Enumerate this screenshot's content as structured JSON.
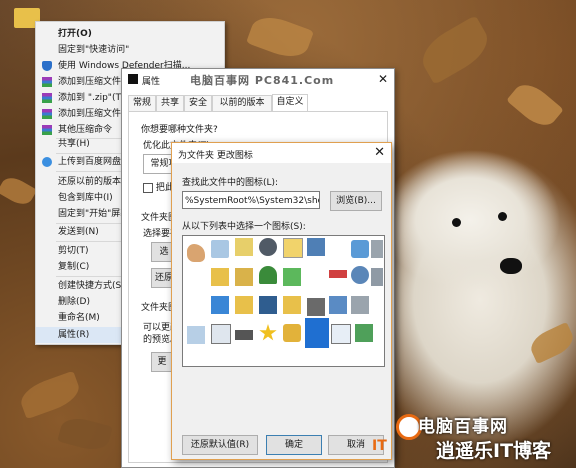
{
  "context_menu": {
    "items": [
      {
        "label": "打开(O)",
        "bold": true,
        "icon": ""
      },
      {
        "label": "固定到\"快速访问\"",
        "icon": ""
      },
      {
        "label": "使用 Windows Defender扫描...",
        "icon": "shield-icon"
      },
      {
        "label": "添加到压缩文件(A)...",
        "icon": "archive-icon"
      },
      {
        "label": "添加到 \".zip\"(T)",
        "icon": "archive-icon"
      },
      {
        "label": "添加到压缩文件并...",
        "icon": "archive-icon"
      },
      {
        "label": "其他压缩命令",
        "icon": "archive-icon"
      },
      {
        "label": "共享(H)",
        "icon": ""
      },
      {
        "label": "上传到百度网盘",
        "icon": "cloud-icon"
      },
      {
        "label": "还原以前的版本(V)",
        "icon": ""
      },
      {
        "label": "包含到库中(I)",
        "icon": ""
      },
      {
        "label": "固定到\"开始\"屏幕(P)",
        "icon": ""
      },
      {
        "label": "发送到(N)",
        "icon": ""
      },
      {
        "label": "剪切(T)",
        "icon": ""
      },
      {
        "label": "复制(C)",
        "icon": ""
      },
      {
        "label": "创建快捷方式(S)",
        "icon": ""
      },
      {
        "label": "删除(D)",
        "icon": ""
      },
      {
        "label": "重命名(M)",
        "icon": ""
      },
      {
        "label": "属性(R)",
        "icon": ""
      }
    ]
  },
  "properties": {
    "title": "属性",
    "watermark": "电脑百事网 PC841.Com",
    "tabs": [
      "常规",
      "共享",
      "安全",
      "以前的版本",
      "自定义"
    ],
    "active_tab": "自定义",
    "section1_label": "你想要哪种文件夹?",
    "optimize_label": "优化此文件夹(T):",
    "optimize_value": "常规项",
    "also_apply": "把此",
    "folder_pic_label": "文件夹图片",
    "select_hint": "选择要在",
    "choose_btn": "选",
    "restore_btn": "还原",
    "folder_icon_label": "文件夹图标",
    "folder_icon_text1": "可以更改",
    "folder_icon_text2": "的预览。",
    "change_btn": "更"
  },
  "change_icon_dialog": {
    "title": "为文件夹 更改图标",
    "find_label": "查找此文件中的图标(L):",
    "path_value": "%SystemRoot%\\System32\\shell32.dll",
    "browse_btn": "浏览(B)...",
    "list_label": "从以下列表中选择一个图标(S):",
    "restore_default_btn": "还原默认值(R)",
    "ok_btn": "确定",
    "cancel_btn": "取消"
  },
  "watermark": {
    "line1": "电脑百事网",
    "line2": "逍遥乐IT博客",
    "prefix": "IT"
  }
}
